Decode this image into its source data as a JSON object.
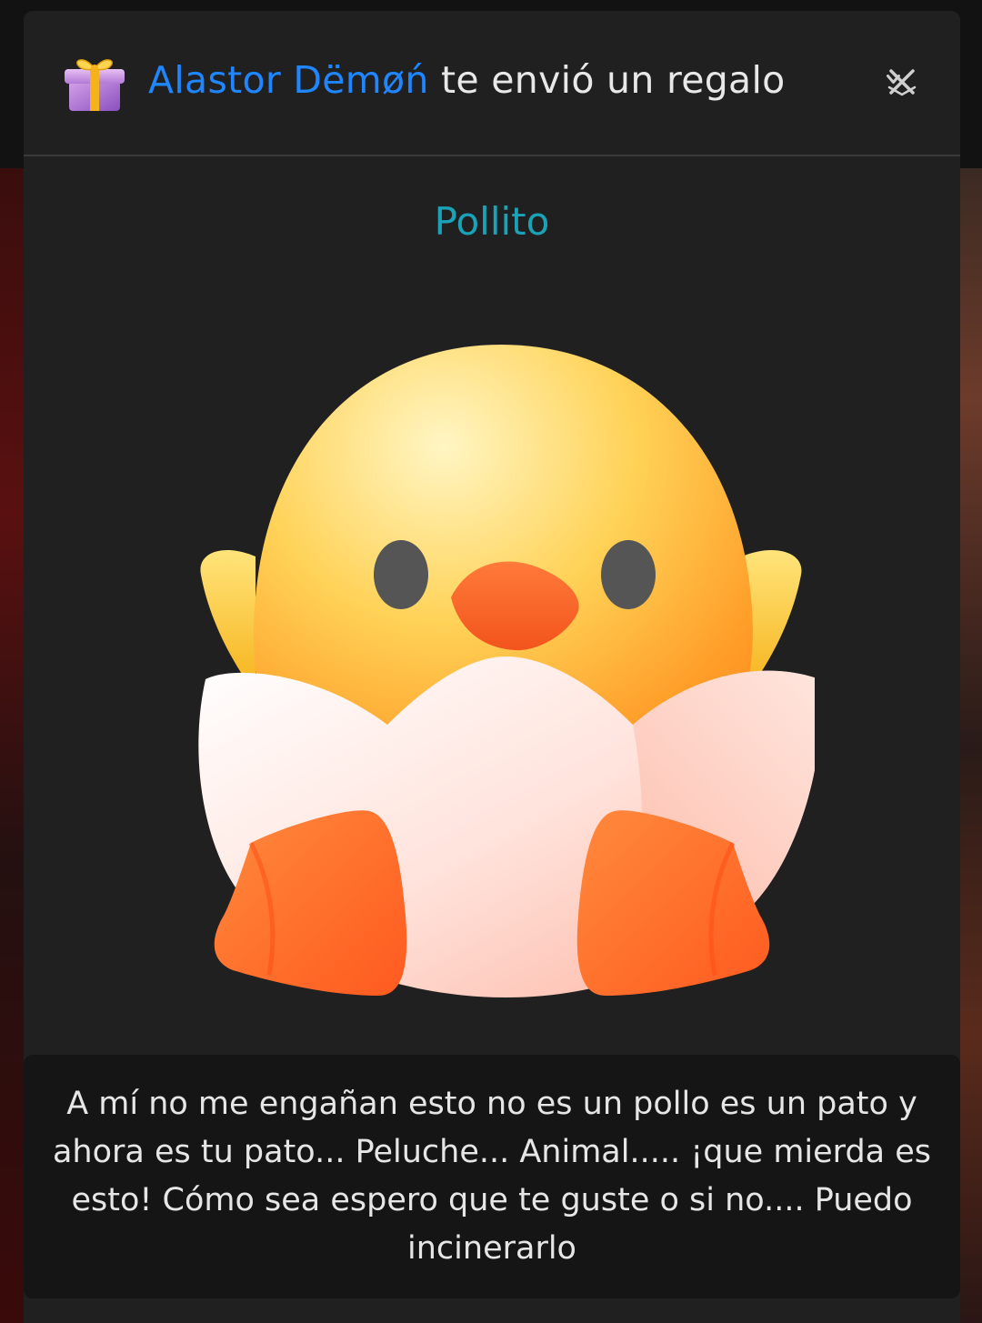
{
  "modal": {
    "header": {
      "sender_name": "Alastor Dëmøń",
      "title_suffix": " te envió un regalo",
      "gift_icon": "gift-box-icon",
      "close_icon": "close-icon"
    },
    "gift": {
      "name": "Pollito",
      "image_icon": "baby-chick-hatching-icon"
    },
    "message": {
      "text": "A mí no me engañan esto no es un pollo es un pato y ahora es tu pato... Peluche... Animal..... ¡que mierda es esto! Cómo sea espero que te guste o si no.... Puedo incinerarlo"
    }
  },
  "colors": {
    "sender_link": "#1f86ff",
    "gift_name": "#1aa3b8",
    "modal_bg": "#202020",
    "message_bg": "#151515"
  }
}
